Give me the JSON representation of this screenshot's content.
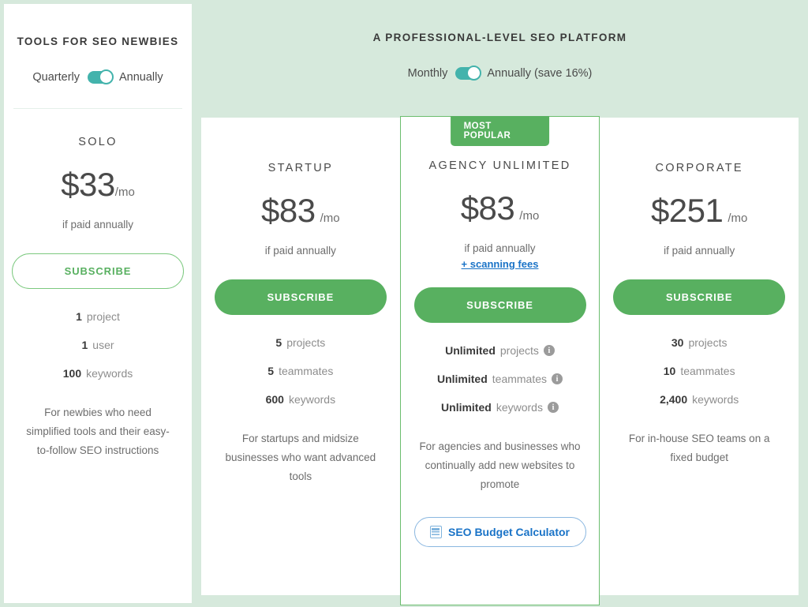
{
  "left_panel": {
    "heading": "TOOLS FOR SEO NEWBIES",
    "toggle": {
      "left_label": "Quarterly",
      "right_label": "Annually",
      "state": "right",
      "accent_color": "#43b3ac"
    },
    "plan": {
      "name": "SOLO",
      "currency_price": "$33",
      "per": "/mo",
      "paid_note": "if paid annually",
      "button_label": "SUBSCRIBE",
      "button_style": "outline",
      "features": [
        {
          "value": "1",
          "label": "project",
          "info": false
        },
        {
          "value": "1",
          "label": "user",
          "info": false
        },
        {
          "value": "100",
          "label": "keywords",
          "info": false
        }
      ],
      "description": "For newbies who need simplified tools and their easy-to-follow SEO instructions"
    }
  },
  "right_panel": {
    "heading": "A PROFESSIONAL-LEVEL SEO PLATFORM",
    "background_color": "#d6e9dc",
    "toggle": {
      "left_label": "Monthly",
      "right_label": "Annually (save 16%)",
      "state": "right",
      "accent_color": "#43b3ac"
    },
    "plans": [
      {
        "name": "STARTUP",
        "currency_price": "$83",
        "per": "/mo",
        "paid_note": "if paid annually",
        "scanning_link": null,
        "badge": null,
        "button_label": "SUBSCRIBE",
        "button_style": "solid",
        "features": [
          {
            "value": "5",
            "label": "projects",
            "info": false
          },
          {
            "value": "5",
            "label": "teammates",
            "info": false
          },
          {
            "value": "600",
            "label": "keywords",
            "info": false
          }
        ],
        "description": "For startups and midsize businesses who want advanced tools",
        "calculator_label": null
      },
      {
        "name": "AGENCY UNLIMITED",
        "currency_price": "$83",
        "per": "/mo",
        "paid_note": "if paid annually",
        "scanning_link": "+ scanning fees",
        "badge": "MOST POPULAR",
        "button_label": "SUBSCRIBE",
        "button_style": "solid",
        "features": [
          {
            "value": "Unlimited",
            "label": "projects",
            "info": true
          },
          {
            "value": "Unlimited",
            "label": "teammates",
            "info": true
          },
          {
            "value": "Unlimited",
            "label": "keywords",
            "info": true
          }
        ],
        "description": "For agencies and businesses who continually add new websites to promote",
        "calculator_label": "SEO Budget Calculator"
      },
      {
        "name": "CORPORATE",
        "currency_price": "$251",
        "per": "/mo",
        "paid_note": "if paid annually",
        "scanning_link": null,
        "badge": null,
        "button_label": "SUBSCRIBE",
        "button_style": "solid",
        "features": [
          {
            "value": "30",
            "label": "projects",
            "info": false
          },
          {
            "value": "10",
            "label": "teammates",
            "info": false
          },
          {
            "value": "2,400",
            "label": "keywords",
            "info": false
          }
        ],
        "description": "For in-house SEO teams on a fixed budget",
        "calculator_label": null
      }
    ]
  },
  "colors": {
    "green_accent": "#58b060",
    "teal_toggle": "#43b3ac",
    "link_blue": "#1a73c7",
    "panel_green": "#d6e9dc"
  }
}
